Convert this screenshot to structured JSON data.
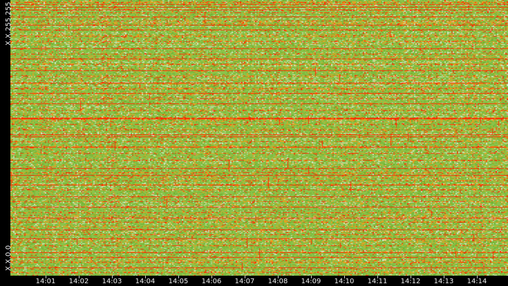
{
  "chart_data": {
    "type": "heatmap",
    "title": "",
    "ylabel_top": "X.X.255.255",
    "ylabel_bottom": "X.X.0.0",
    "xtick_labels": [
      "14:01",
      "14:02",
      "14:03",
      "14:04",
      "14:05",
      "14:06",
      "14:07",
      "14:08",
      "14:09",
      "14:10",
      "14:11",
      "14:12",
      "14:13",
      "14:14"
    ],
    "xlim": [
      "14:00",
      "14:15"
    ],
    "ylim": [
      "X.X.0.0",
      "X.X.255.255"
    ],
    "colors": {
      "background": "#000000",
      "low": "#8bc34a",
      "mid_low": "#6fb232",
      "mid": "#e6a020",
      "high": "#ff2a00",
      "very_low": "#cfe8c0"
    },
    "heavy_rows": [
      6,
      10,
      14,
      24,
      36,
      43,
      70,
      85,
      102,
      120,
      135,
      150,
      171,
      172,
      195,
      198,
      213,
      244,
      254,
      268,
      285,
      300,
      316,
      333,
      346,
      366,
      373,
      388
    ],
    "medium_rows": [
      3,
      18,
      30,
      52,
      60,
      78,
      93,
      110,
      128,
      143,
      160,
      180,
      188,
      205,
      222,
      232,
      250,
      262,
      275,
      292,
      308,
      322,
      340,
      356,
      380,
      395
    ]
  }
}
